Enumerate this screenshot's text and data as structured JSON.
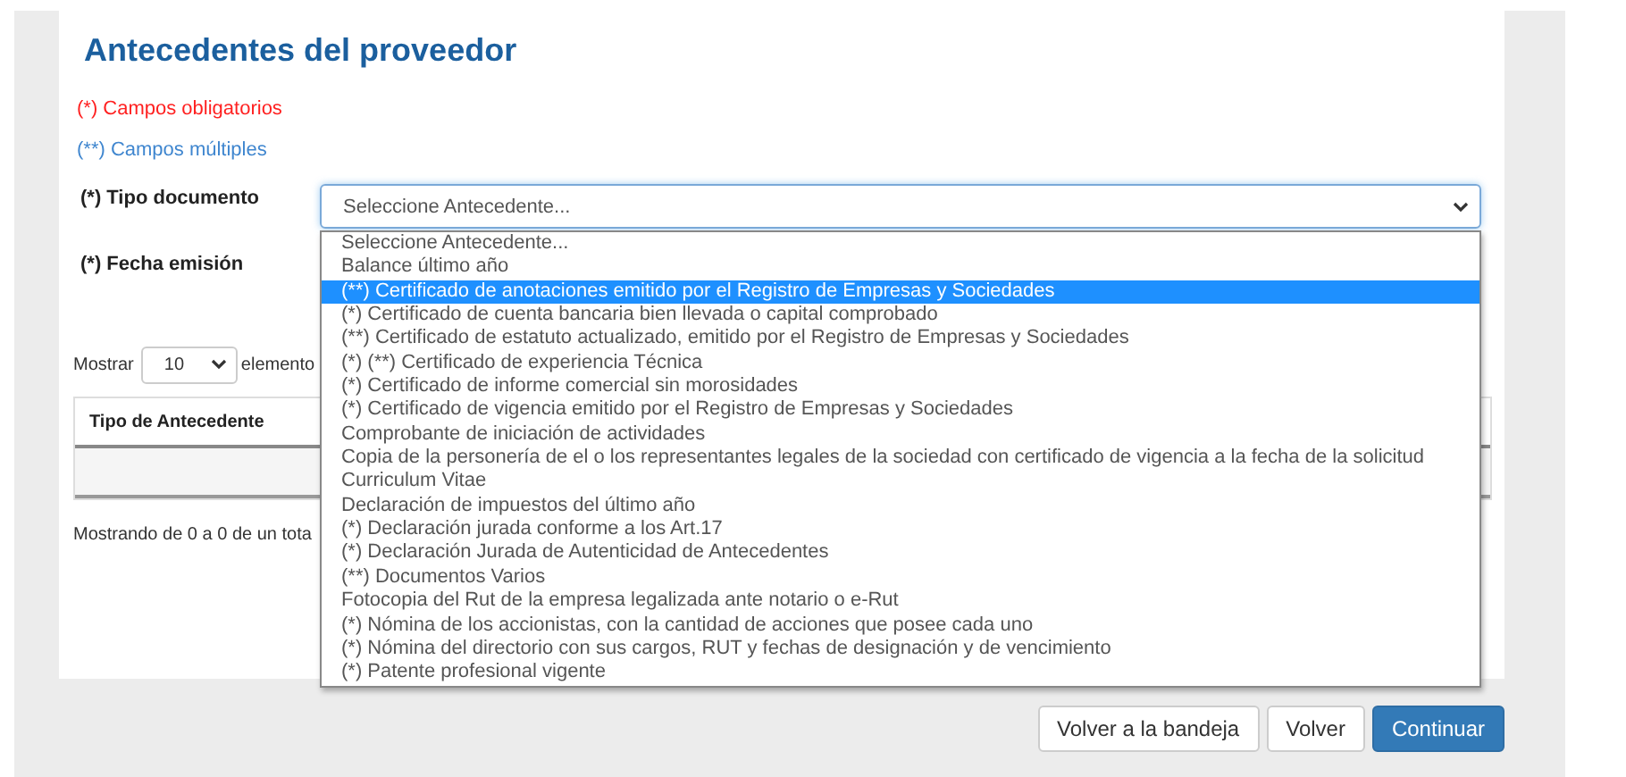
{
  "page": {
    "title": "Antecedentes del proveedor"
  },
  "legend": [
    {
      "kind": "required",
      "text": "(*) Campos obligatorios"
    },
    {
      "kind": "multiple",
      "text": "(**) Campos múltiples"
    }
  ],
  "form": {
    "fields": [
      {
        "label": "(*) Tipo documento",
        "kind": "select",
        "value": "Seleccione Antecedente...",
        "expanded": true,
        "options": [
          {
            "label": "Seleccione Antecedente...",
            "highlighted": false
          },
          {
            "label": "Balance último año",
            "highlighted": false
          },
          {
            "label": "(**) Certificado de anotaciones emitido por el Registro de Empresas y Sociedades",
            "highlighted": true
          },
          {
            "label": "(*) Certificado de cuenta bancaria bien llevada o capital comprobado",
            "highlighted": false
          },
          {
            "label": "(**) Certificado de estatuto actualizado, emitido por el Registro de Empresas y Sociedades",
            "highlighted": false
          },
          {
            "label": "(*) (**) Certificado de experiencia Técnica",
            "highlighted": false
          },
          {
            "label": "(*) Certificado de informe comercial sin morosidades",
            "highlighted": false
          },
          {
            "label": "(*) Certificado de vigencia emitido por el Registro de Empresas y Sociedades",
            "highlighted": false
          },
          {
            "label": "Comprobante de iniciación de actividades",
            "highlighted": false
          },
          {
            "label": "Copia de la personería de el o los representantes legales de la sociedad con certificado de vigencia a la fecha de la solicitud",
            "highlighted": false
          },
          {
            "label": "Curriculum Vitae",
            "highlighted": false
          },
          {
            "label": "Declaración de impuestos del último año",
            "highlighted": false
          },
          {
            "label": "(*) Declaración jurada conforme a los Art.17",
            "highlighted": false
          },
          {
            "label": "(*) Declaración Jurada de Autenticidad de Antecedentes",
            "highlighted": false
          },
          {
            "label": "(**) Documentos Varios",
            "highlighted": false
          },
          {
            "label": "Fotocopia del Rut de la empresa legalizada ante notario o e-Rut",
            "highlighted": false
          },
          {
            "label": "(*) Nómina de los accionistas, con la cantidad de acciones que posee cada uno",
            "highlighted": false
          },
          {
            "label": "(*) Nómina del directorio con sus cargos, RUT y fechas de designación y de vencimiento",
            "highlighted": false
          },
          {
            "label": "(*) Patente profesional vigente",
            "highlighted": false
          }
        ]
      },
      {
        "label": "(*) Fecha emisión",
        "kind": "date"
      }
    ]
  },
  "table_controls": {
    "show_label": "Mostrar",
    "page_size": "10",
    "suffix": "elemento"
  },
  "table": {
    "columns": [
      "Tipo de Antecedente"
    ]
  },
  "info": "Mostrando de 0 a 0 de un tota",
  "buttons": [
    {
      "label": "Volver a la bandeja",
      "primary": false
    },
    {
      "label": "Volver",
      "primary": false
    },
    {
      "label": "Continuar",
      "primary": true
    }
  ]
}
